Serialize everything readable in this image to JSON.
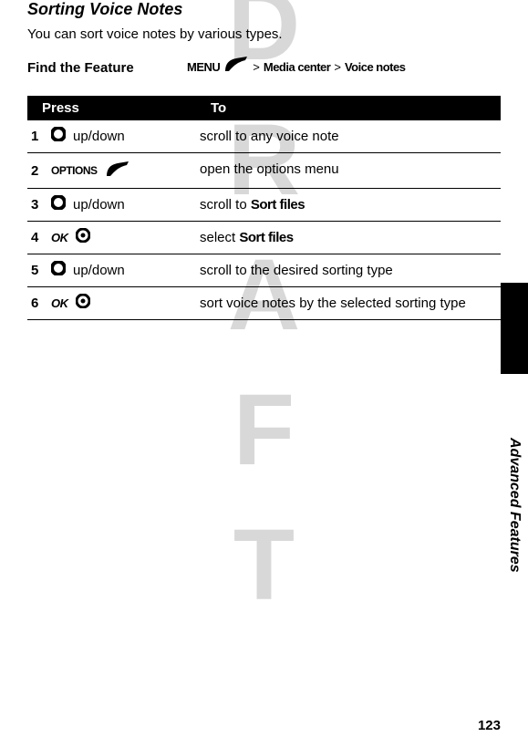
{
  "title": "Sorting Voice Notes",
  "intro": "You can sort voice notes by various types.",
  "findFeature": "Find the Feature",
  "path": {
    "menu": "MENU",
    "sep1": ">",
    "mediaCenter": "Media center",
    "sep2": ">",
    "voiceNotes": "Voice notes"
  },
  "headers": {
    "press": "Press",
    "to": "To"
  },
  "steps": [
    {
      "num": "1",
      "action": "up/down",
      "to": "scroll to any voice note",
      "type": "nav"
    },
    {
      "num": "2",
      "action": "OPTIONS",
      "to": "open the options menu",
      "type": "options"
    },
    {
      "num": "3",
      "action": "up/down",
      "to_prefix": "scroll to ",
      "to_bold": "Sort files",
      "type": "nav"
    },
    {
      "num": "4",
      "action": "OK",
      "to_prefix": "select ",
      "to_bold": "Sort files",
      "type": "ok"
    },
    {
      "num": "5",
      "action": "up/down",
      "to": "scroll to the desired sorting type",
      "type": "nav"
    },
    {
      "num": "6",
      "action": "OK",
      "to": "sort voice notes by the selected sorting type",
      "type": "ok"
    }
  ],
  "sideLabel": "Advanced Features",
  "pageNum": "123",
  "watermark": "DRAFT"
}
